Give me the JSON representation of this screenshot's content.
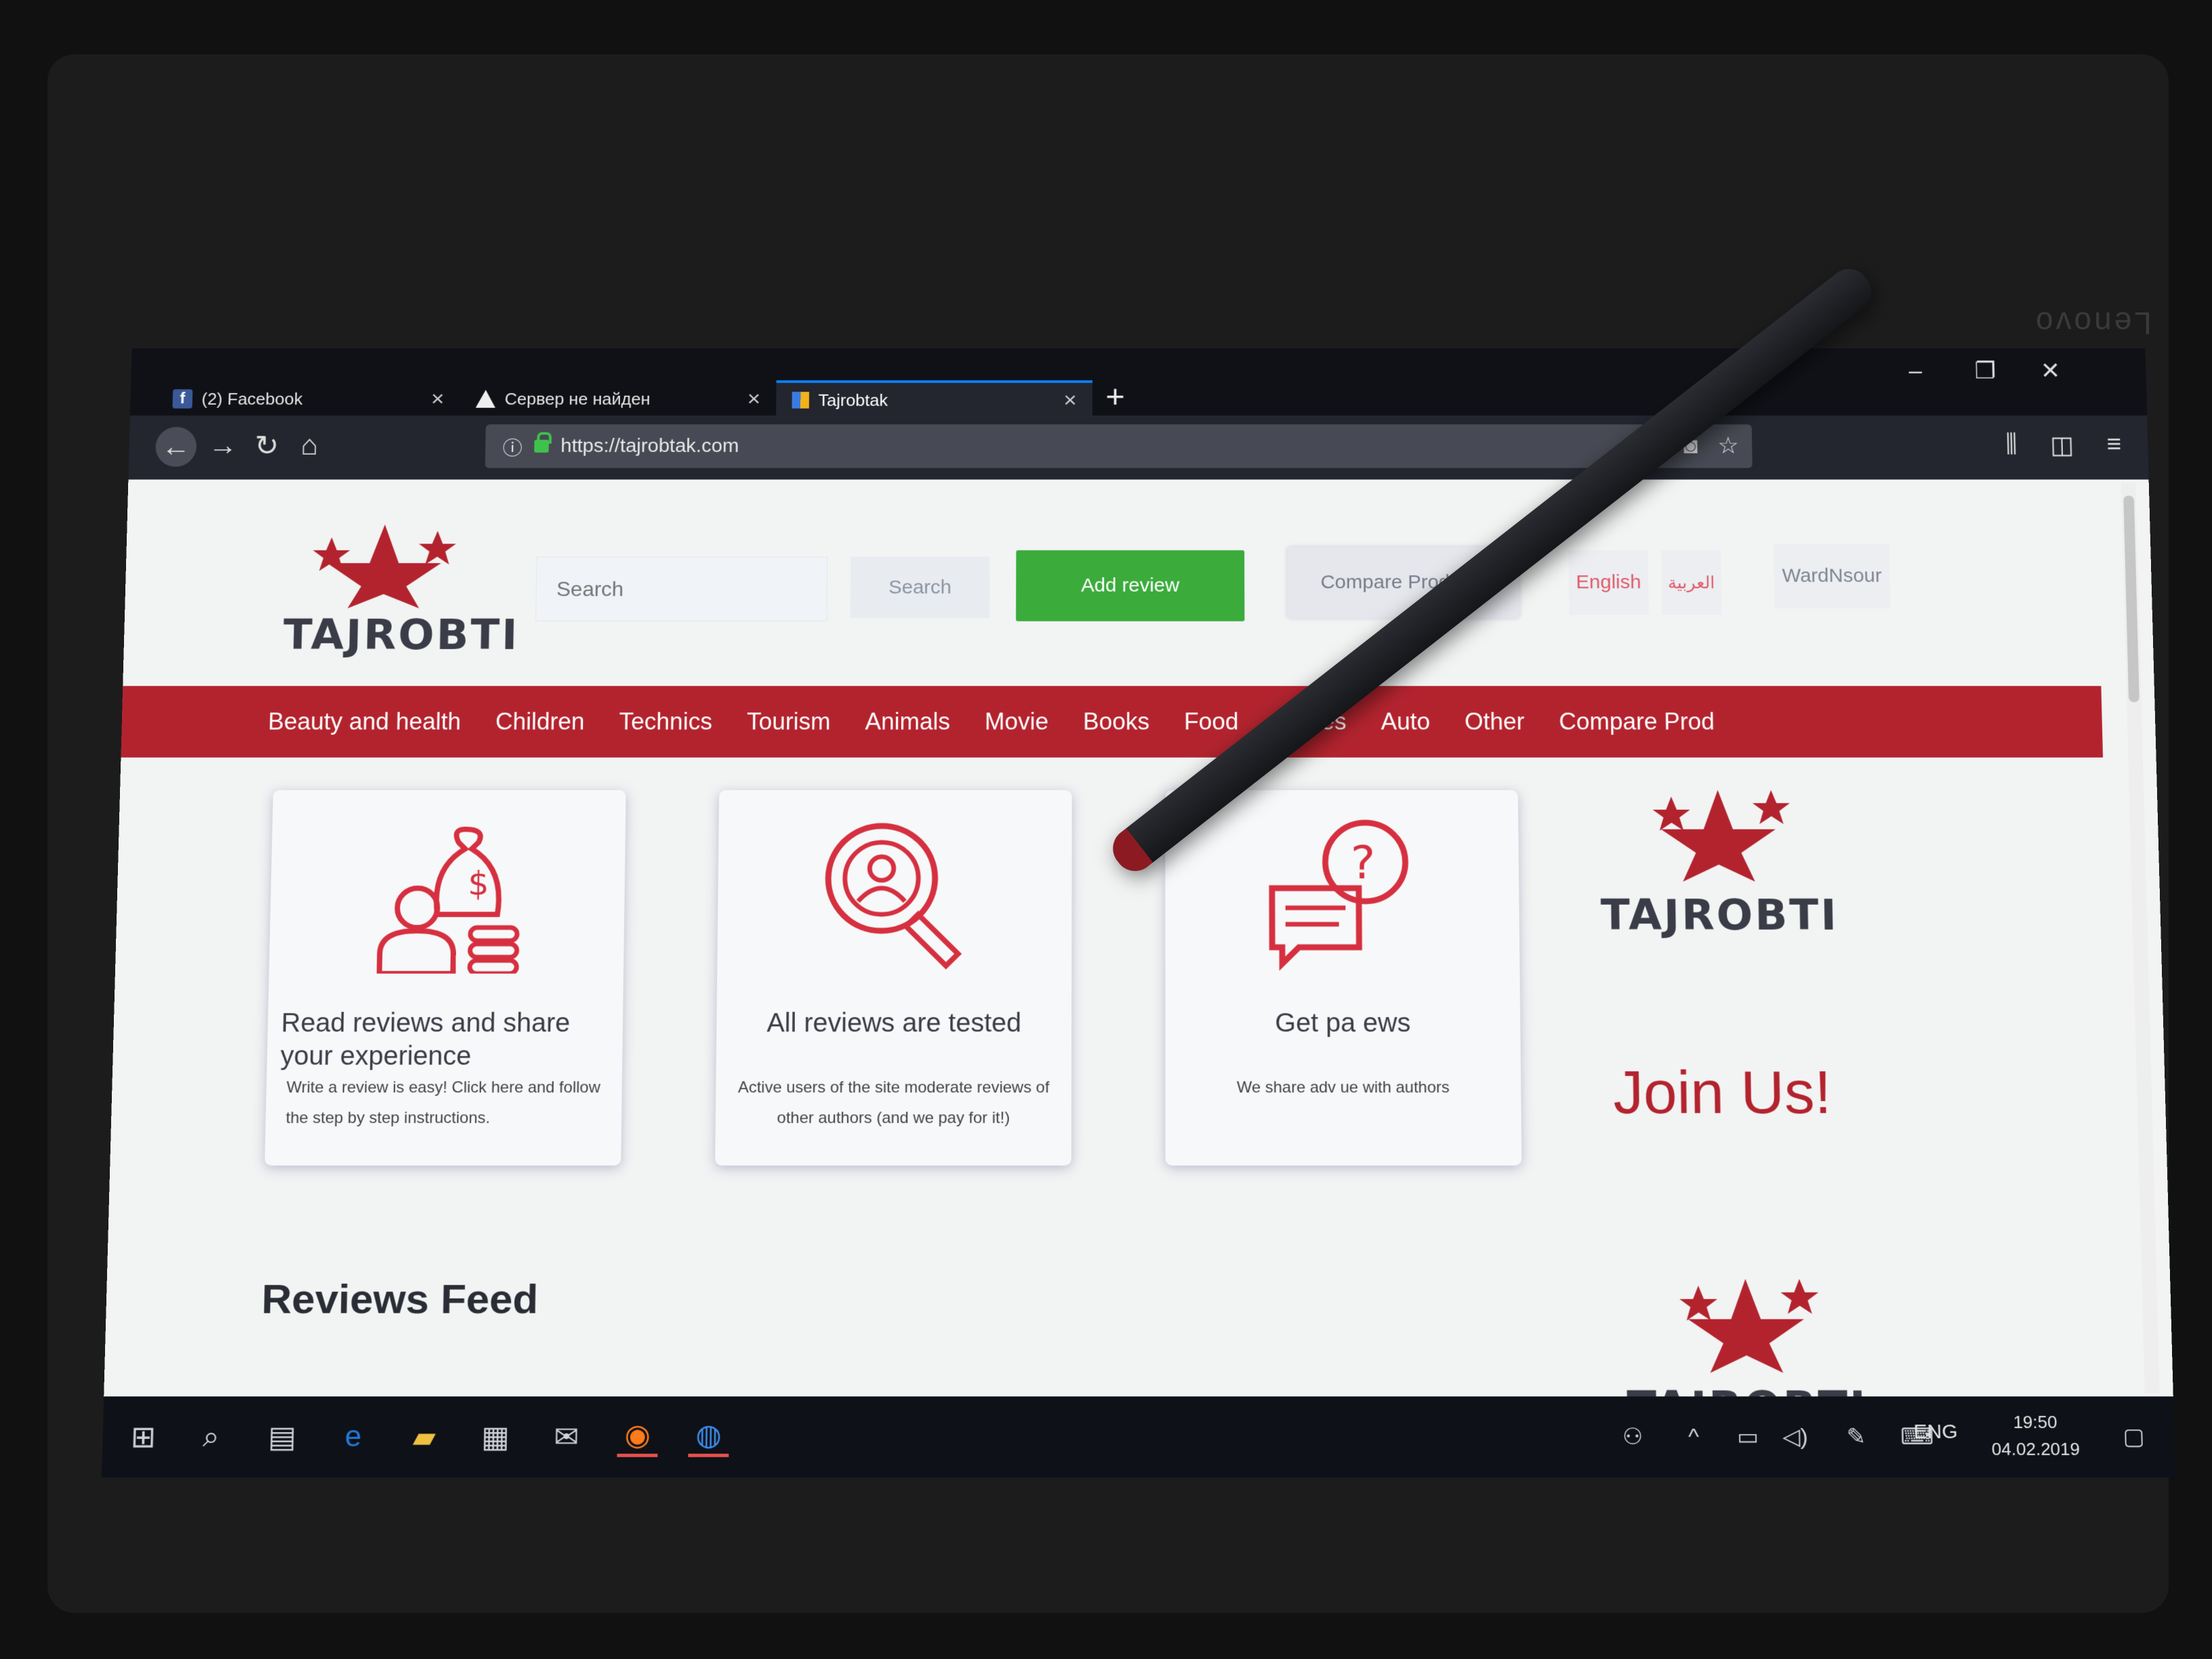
{
  "laptop": {
    "brand": "Lenovo"
  },
  "browser": {
    "tabs": [
      {
        "label": "(2) Facebook",
        "icon": "facebook-icon"
      },
      {
        "label": "Сервер не найден",
        "icon": "warning-icon"
      },
      {
        "label": "Tajrobtak",
        "icon": "site-favicon",
        "active": true
      }
    ],
    "url": "https://tajrobtak.com"
  },
  "site": {
    "logo_text": "TAJROBTI",
    "search_placeholder": "Search",
    "search_button": "Search",
    "add_review": "Add review",
    "compare_products": "Compare Products",
    "lang_english": "English",
    "lang_arabic": "العربية",
    "user": "WardNsour",
    "categories": [
      "Beauty and health",
      "Children",
      "Technics",
      "Tourism",
      "Animals",
      "Movie",
      "Books",
      "Food",
      "Dishes",
      "Auto",
      "Other",
      "Compare Prod"
    ],
    "cards": [
      {
        "title": "Read reviews and share your experience",
        "text": "Write a review is easy! Click here and follow the step by step instructions."
      },
      {
        "title": "All reviews are tested",
        "text": "Active users of the site moderate reviews of other authors (and we pay for it!)"
      },
      {
        "title": "Get pa           ews",
        "text": "We share adv                  ue with authors"
      }
    ],
    "join": "Join Us!",
    "feed_title": "Reviews Feed",
    "brand_color": "#b3232e",
    "accent_green": "#3bab3c"
  },
  "taskbar": {
    "lang": "ENG",
    "time": "19:50",
    "date": "04.02.2019"
  }
}
